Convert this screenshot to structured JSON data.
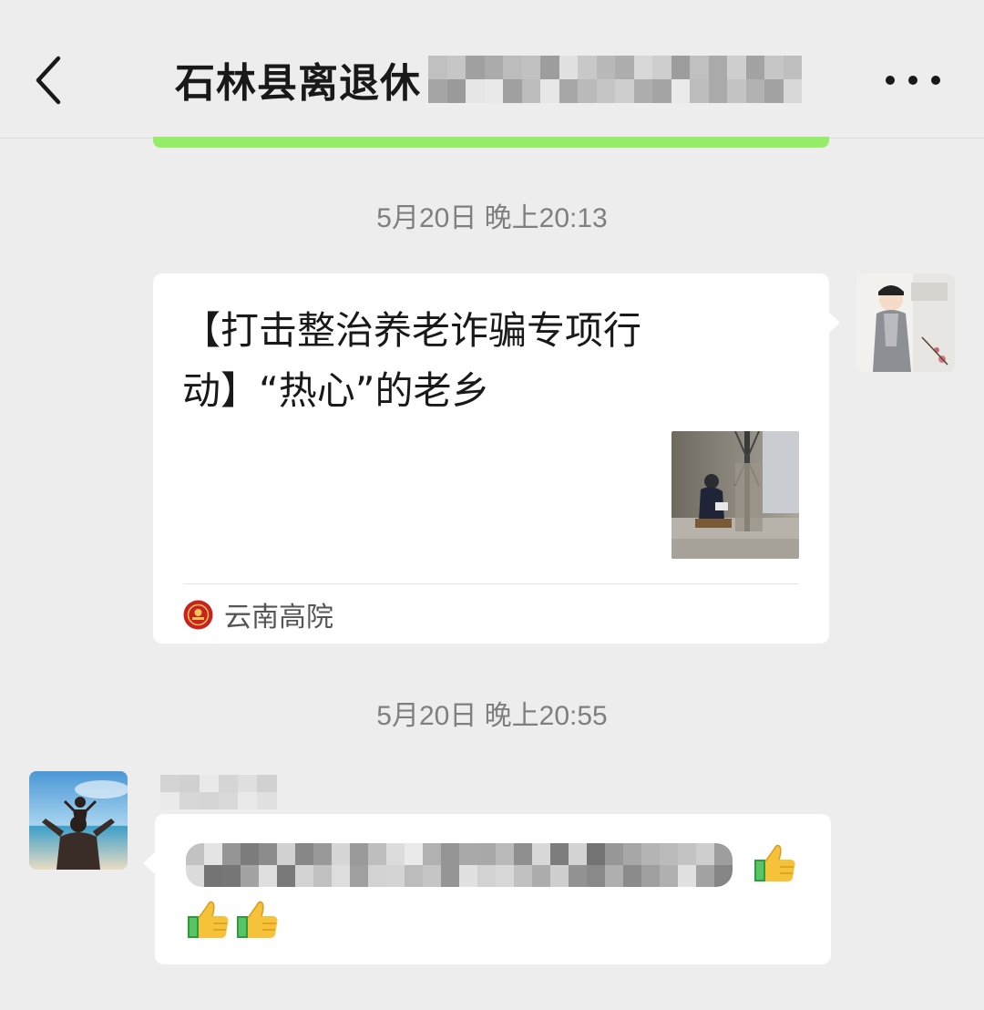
{
  "header": {
    "title_visible": "石林县离退休",
    "back_icon": "chevron-left-icon",
    "more_icon": "more-dots-icon"
  },
  "messages": {
    "timestamp_1": "5月20日 晚上20:13",
    "card": {
      "title": "【打击整治养老诈骗专项行动】“热心”的老乡",
      "source_name": "云南高院"
    },
    "timestamp_2": "5月20日 晚上20:55"
  },
  "colors": {
    "background": "#ededed",
    "bubble": "#ffffff",
    "accent_green": "#95ec69",
    "timestamp": "#7f7f7f"
  }
}
